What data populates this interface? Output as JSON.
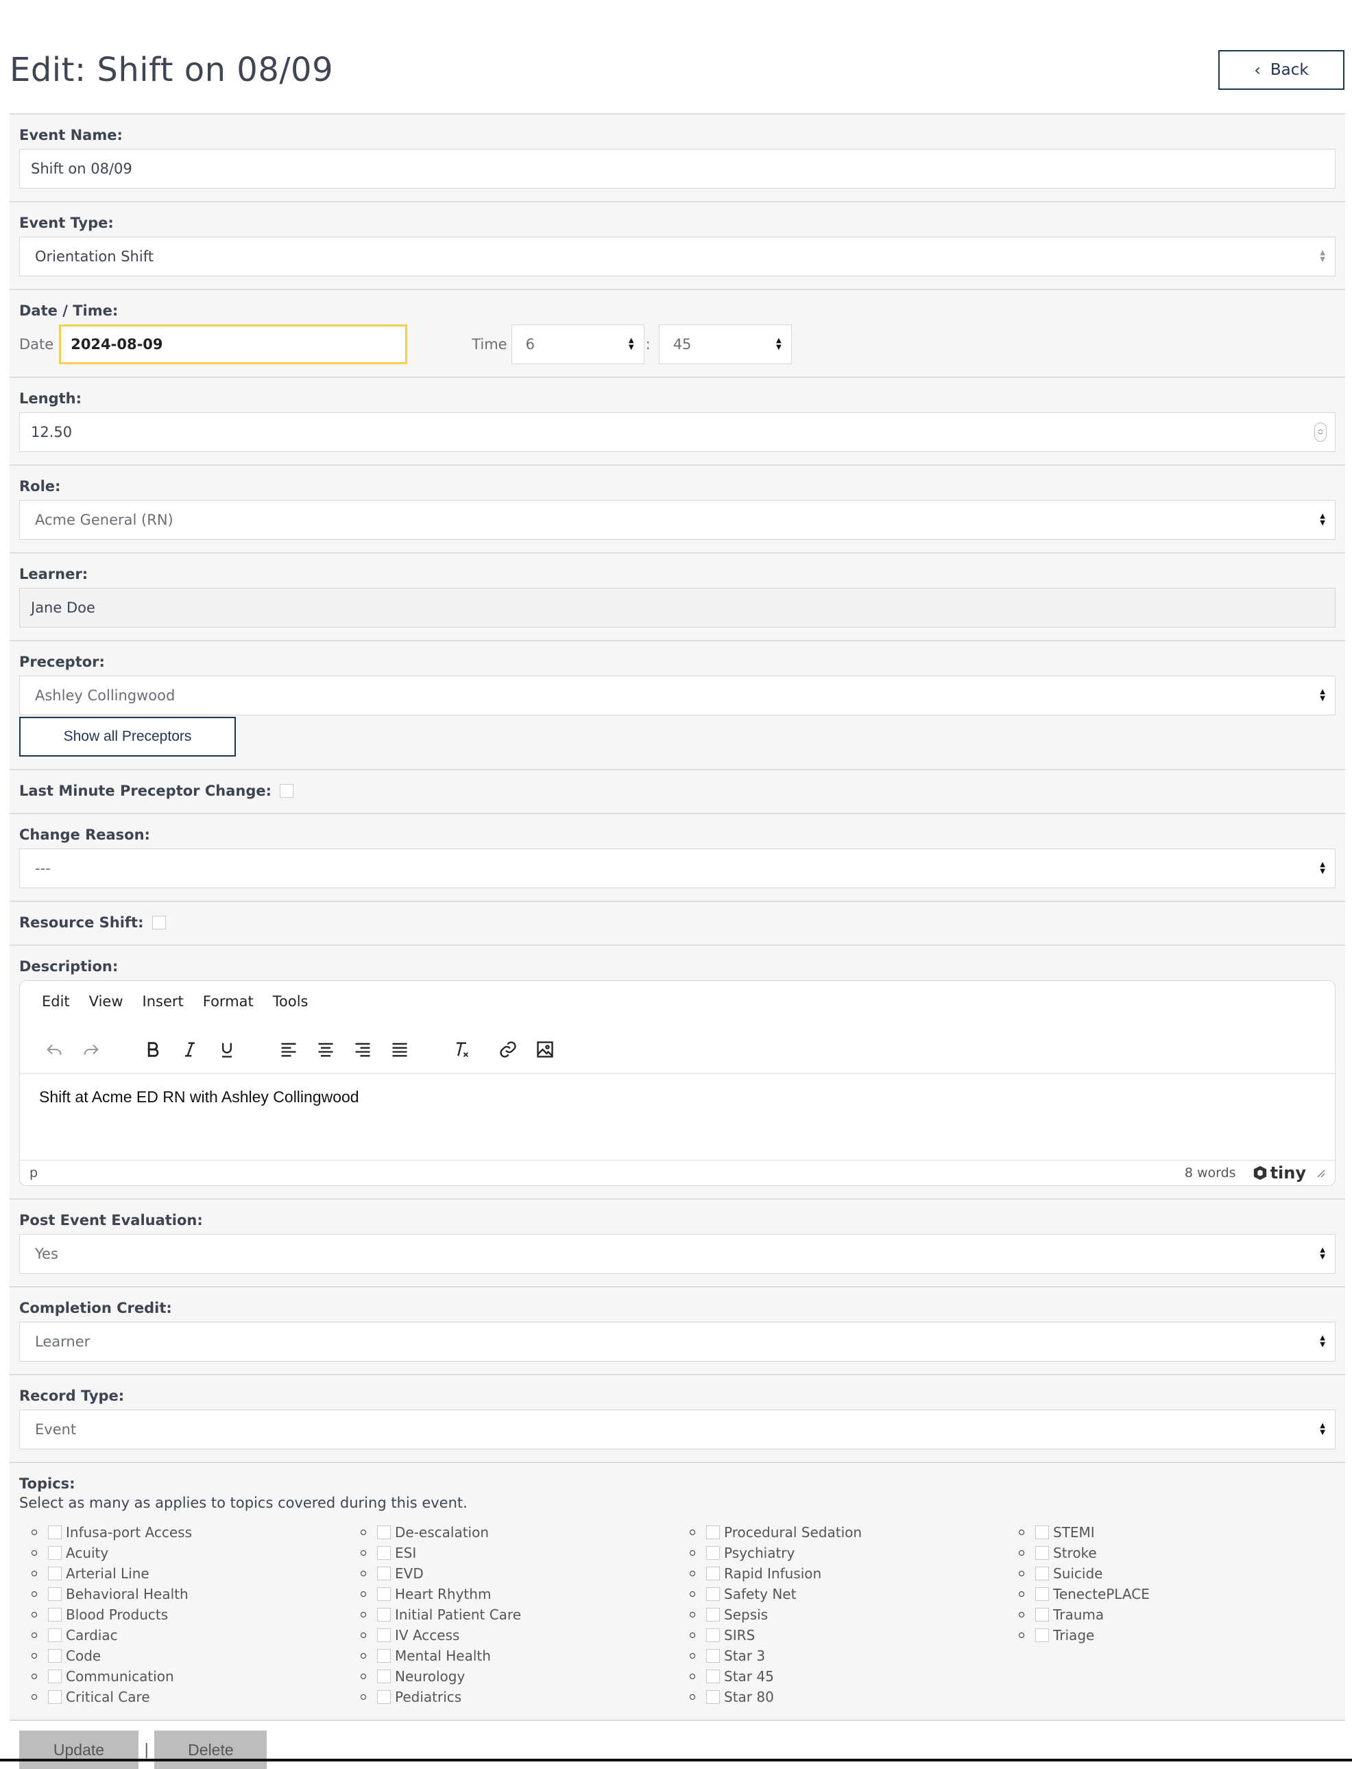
{
  "page": {
    "title": "Edit: Shift on 08/09",
    "back_label": "Back"
  },
  "event_name": {
    "label": "Event Name:",
    "value": "Shift on 08/09"
  },
  "event_type": {
    "label": "Event Type:",
    "value": "Orientation Shift"
  },
  "date_time": {
    "label": "Date / Time:",
    "date_label": "Date",
    "date_value": "2024-08-09",
    "time_label": "Time",
    "hour": "6",
    "minute": "45",
    "separator": ":"
  },
  "length": {
    "label": "Length:",
    "value": "12.50"
  },
  "role": {
    "label": "Role:",
    "value": "Acme General (RN)"
  },
  "learner": {
    "label": "Learner:",
    "value": "Jane Doe"
  },
  "preceptor": {
    "label": "Preceptor:",
    "value": "Ashley Collingwood",
    "show_all_label": "Show all Preceptors"
  },
  "last_minute_change": {
    "label": "Last Minute Preceptor Change:",
    "checked": false
  },
  "change_reason": {
    "label": "Change Reason:",
    "value": "---"
  },
  "resource_shift": {
    "label": "Resource Shift:",
    "checked": false
  },
  "description": {
    "label": "Description:",
    "menu": [
      "Edit",
      "View",
      "Insert",
      "Format",
      "Tools"
    ],
    "content": "Shift at Acme ED RN with Ashley Collingwood",
    "path": "p",
    "word_count": "8 words",
    "brand": "tiny"
  },
  "post_event_evaluation": {
    "label": "Post Event Evaluation:",
    "value": "Yes"
  },
  "completion_credit": {
    "label": "Completion Credit:",
    "value": "Learner"
  },
  "record_type": {
    "label": "Record Type:",
    "value": "Event"
  },
  "topics": {
    "label": "Topics:",
    "help": "Select as many as applies to topics covered during this event.",
    "columns": [
      [
        "Infusa-port Access",
        "Acuity",
        "Arterial Line",
        "Behavioral Health",
        "Blood Products",
        "Cardiac",
        "Code",
        "Communication",
        "Critical Care"
      ],
      [
        "De-escalation",
        "ESI",
        "EVD",
        "Heart Rhythm",
        "Initial Patient Care",
        "IV Access",
        "Mental Health",
        "Neurology",
        "Pediatrics"
      ],
      [
        "Procedural Sedation",
        "Psychiatry",
        "Rapid Infusion",
        "Safety Net",
        "Sepsis",
        "SIRS",
        "Star 3",
        "Star 45",
        "Star 80"
      ],
      [
        "STEMI",
        "Stroke",
        "Suicide",
        "TenectePLACE",
        "Trauma",
        "Triage"
      ]
    ]
  },
  "actions": {
    "update_label": "Update",
    "separator": "|",
    "delete_label": "Delete"
  }
}
